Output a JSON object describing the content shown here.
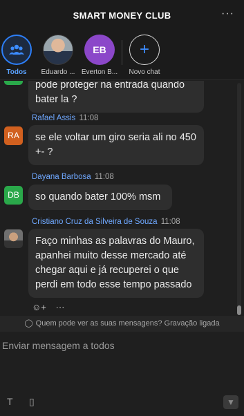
{
  "header": {
    "title": "SMART MONEY CLUB",
    "more": "···"
  },
  "tabs": [
    {
      "label": "Todos",
      "icon": "group-icon"
    },
    {
      "label": "Eduardo ...",
      "icon": "avatar-photo"
    },
    {
      "label": "Everton B...",
      "initials": "EB"
    },
    {
      "label": "Novo chat",
      "icon": "plus-icon"
    }
  ],
  "messages": [
    {
      "text": "pode proteger na entrada quando bater la ?"
    },
    {
      "sender": "Rafael Assis",
      "time": "11:08",
      "avatar": "RA",
      "text": "se ele voltar um giro seria ali no 450 +- ?"
    },
    {
      "sender": "Dayana Barbosa",
      "time": "11:08",
      "avatar": "DB",
      "text": "so quando bater 100% msm"
    },
    {
      "sender": "Cristiano Cruz da Silveira de Souza",
      "time": "11:08",
      "text": "Faço minhas as palavras do Mauro, apanhei muito desse mercado até chegar aqui e já recuperei o que perdi em todo esse tempo passado"
    }
  ],
  "reactions": {
    "add": "☺+",
    "more": "···"
  },
  "notice": "Quem pode ver as suas mensagens? Gravação ligada",
  "compose": {
    "placeholder": "Enviar mensagem a todos",
    "format": "T",
    "file": "▯"
  },
  "colors": {
    "accent": "#2d7ff9",
    "sender": "#6fa8ff",
    "bubble": "#2e2e2e",
    "background": "#1f1f1f"
  }
}
